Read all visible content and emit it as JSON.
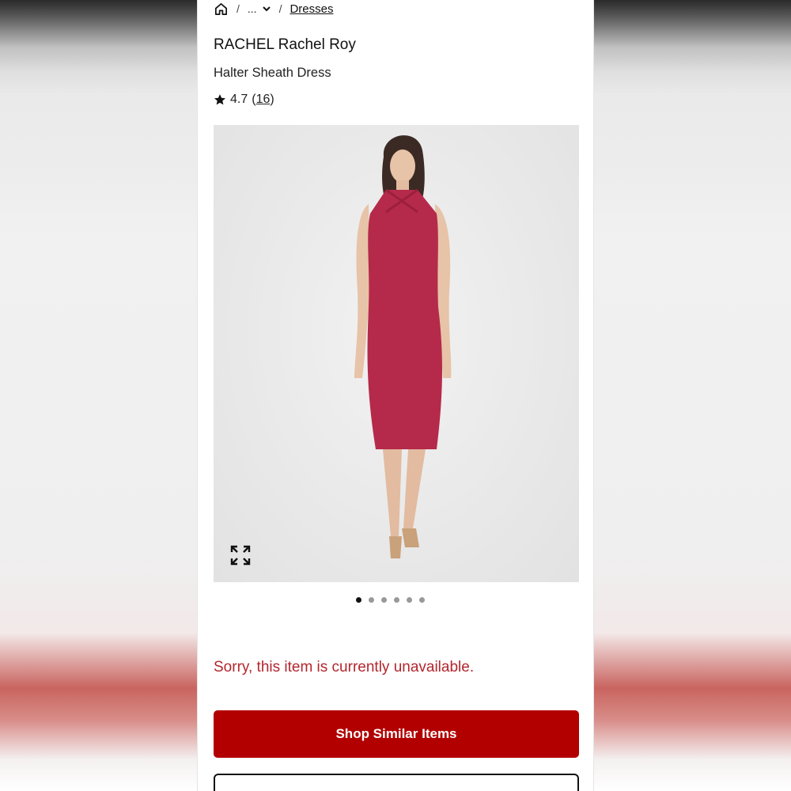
{
  "breadcrumb": {
    "separator": "/",
    "more_label": "...",
    "current_label": "Dresses"
  },
  "product": {
    "brand": "RACHEL Rachel Roy",
    "name": "Halter Sheath Dress",
    "rating": "4.7",
    "review_count": "16",
    "icons": {
      "rating": "star-icon",
      "expand": "expand-icon",
      "home": "home-icon",
      "more": "chevron-down-icon"
    }
  },
  "gallery": {
    "dot_count": 6,
    "active_index": 0,
    "dress_color": "#b52a4a"
  },
  "status": {
    "message": "Sorry, this item is currently unavailable.",
    "color": "#b3262d"
  },
  "actions": {
    "shop_similar_label": "Shop Similar Items",
    "primary_color": "#b20000"
  }
}
